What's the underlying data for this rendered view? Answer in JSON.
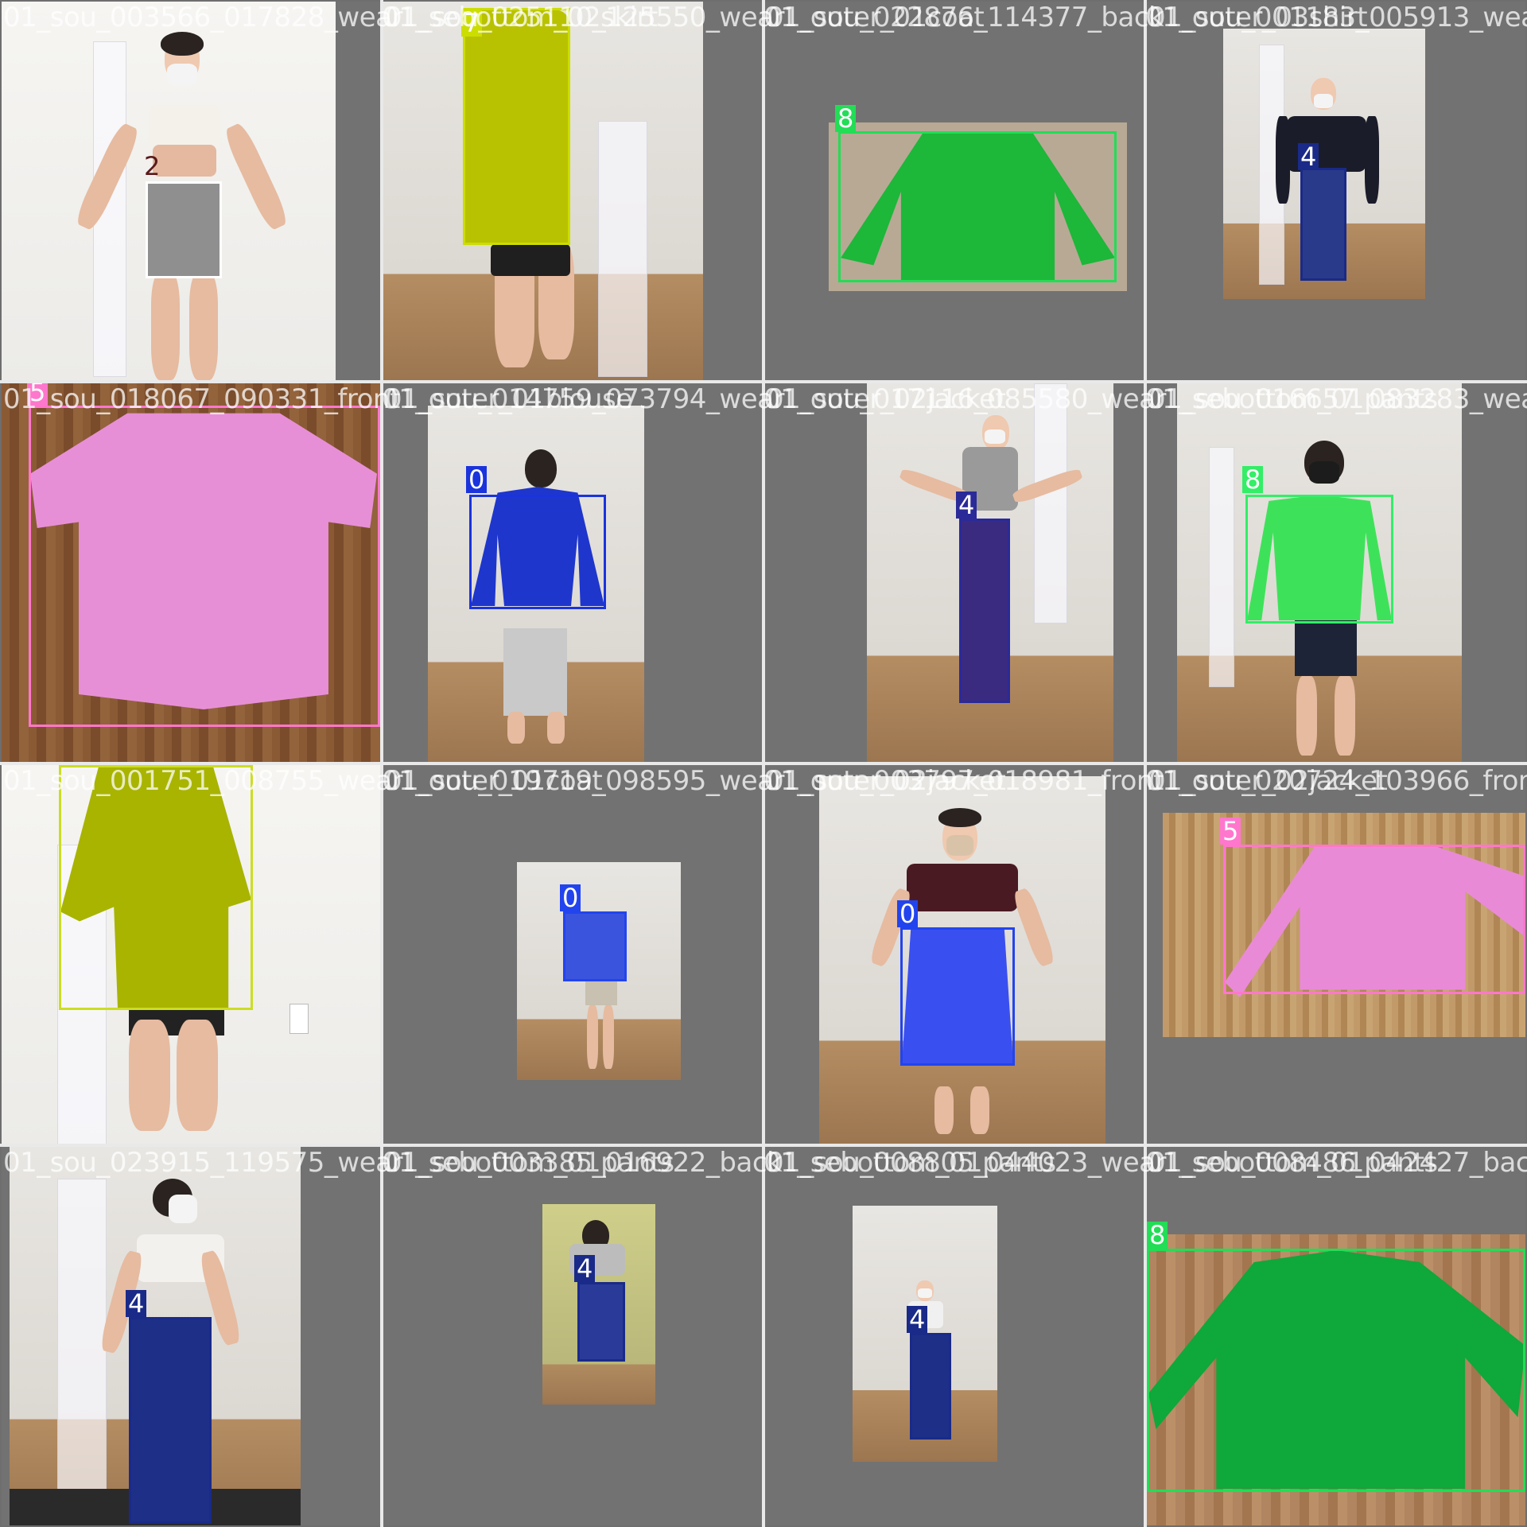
{
  "tiles": [
    {
      "row": 0,
      "col": 0,
      "filename": "01_sou_003566_017828_wear",
      "overlap": "",
      "class_id": "2",
      "color": "#cccccc",
      "tag_text_color": "#5a1a1a"
    },
    {
      "row": 0,
      "col": 1,
      "filename": "01_sou_025110_125550_wear",
      "overlap": "01_sebottom_02skirt",
      "class_id": "7",
      "color": "#ccdd00",
      "tag_text_color": "#ffffff"
    },
    {
      "row": 0,
      "col": 2,
      "filename": "01_sou_022876_114377_back",
      "overlap": "01_outer_01coat",
      "class_id": "8",
      "color": "#22dd55",
      "tag_text_color": "#ffffff"
    },
    {
      "row": 0,
      "col": 3,
      "filename": "01_sou_001183_005913_wear",
      "overlap": "01_outer_03shirt",
      "class_id": "4",
      "color": "#1a2a88",
      "tag_text_color": "#ffffff"
    },
    {
      "row": 1,
      "col": 0,
      "filename": "01_sou_018067_090331_front",
      "overlap": "01_sebottom_01blouse",
      "class_id": "5",
      "color": "#ff77cc",
      "tag_text_color": "#ffffff"
    },
    {
      "row": 1,
      "col": 1,
      "filename": "01_sou_014759_073794_wear",
      "overlap": "01_outer_01blouse",
      "class_id": "0",
      "color": "#1a33dd",
      "tag_text_color": "#ffffff"
    },
    {
      "row": 1,
      "col": 2,
      "filename": "01_sou_017116_085580_wear",
      "overlap": "01_outer_02jacket",
      "class_id": "4",
      "color": "#2a2a99",
      "tag_text_color": "#ffffff"
    },
    {
      "row": 1,
      "col": 3,
      "filename": "01_sou_016657_083283_wear",
      "overlap": "01_sebottom_01pants",
      "class_id": "8",
      "color": "#33ee66",
      "tag_text_color": "#ffffff"
    },
    {
      "row": 2,
      "col": 0,
      "filename": "01_sou_001751_008755_wear",
      "overlap": "",
      "class_id": "7",
      "color": "#ccdd22",
      "tag_text_color": "#ffffff"
    },
    {
      "row": 2,
      "col": 1,
      "filename": "01_sou_019719_098595_wear",
      "overlap": "01_outer_01coat",
      "class_id": "0",
      "color": "#2244ee",
      "tag_text_color": "#ffffff"
    },
    {
      "row": 2,
      "col": 2,
      "filename": "01_sou_003797_018981_front",
      "overlap": "01_outer_02jacket",
      "class_id": "0",
      "color": "#2244ee",
      "tag_text_color": "#ffffff"
    },
    {
      "row": 2,
      "col": 3,
      "filename": "01_sou_020724_103966_front",
      "overlap": "01_outer_02jacket",
      "class_id": "5",
      "color": "#ff77cc",
      "tag_text_color": "#ffffff"
    },
    {
      "row": 3,
      "col": 0,
      "filename": "01_sou_023915_119575_wear",
      "overlap": "",
      "class_id": "4",
      "color": "#1a2a88",
      "tag_text_color": "#ffffff"
    },
    {
      "row": 3,
      "col": 1,
      "filename": "01_sou_003385_016922_back",
      "overlap": "01_sebottom_01pants",
      "class_id": "4",
      "color": "#1a2a88",
      "tag_text_color": "#ffffff"
    },
    {
      "row": 3,
      "col": 2,
      "filename": "01_sou_008805_044023_wear",
      "overlap": "01_sebottom_01pants",
      "class_id": "4",
      "color": "#1a2a88",
      "tag_text_color": "#ffffff"
    },
    {
      "row": 3,
      "col": 3,
      "filename": "01_sou_008486_042427_back",
      "overlap": "01_sebottom_01pants",
      "class_id": "8",
      "color": "#22dd55",
      "tag_text_color": "#ffffff"
    }
  ]
}
